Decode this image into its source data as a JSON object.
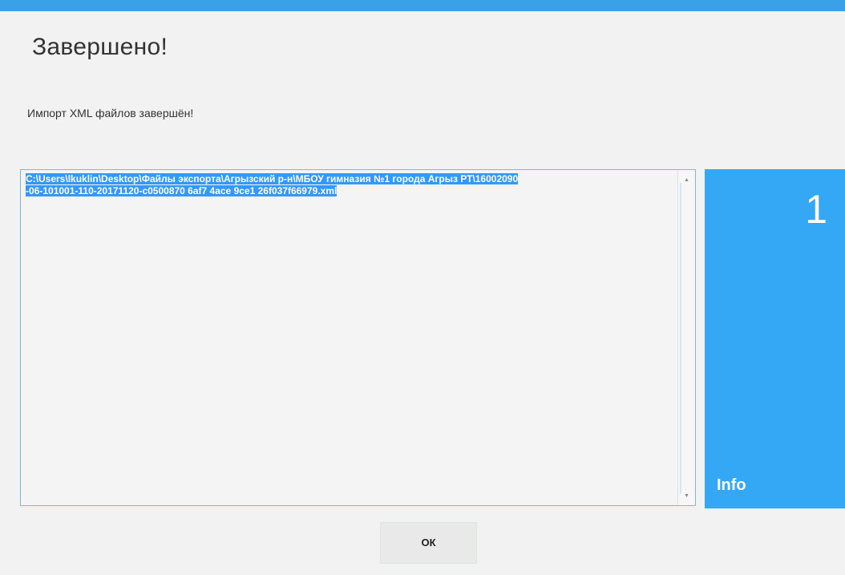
{
  "dialog": {
    "title": "Завершено!",
    "message": "Импорт XML файлов завершён!"
  },
  "log": {
    "lines": [
      "C:\\Users\\lkuklin\\Desktop\\Файлы экспорта\\Агрызский р-н\\МБОУ гимназия №1 города Агрыз РТ\\16002090",
      "-06-101001-110-20171120-c0500870 6af7 4ace 9ce1 26f037f66979.xml"
    ],
    "selected": true
  },
  "info_tile": {
    "count": "1",
    "label": "Info"
  },
  "buttons": {
    "ok_label": "ОК"
  },
  "colors": {
    "accent": "#3aa0e8",
    "tile": "#35a8f5",
    "selection": "#3399ff",
    "background": "#f2f2f2"
  },
  "icons": {
    "scroll_up": "triangle-up-icon",
    "scroll_down": "triangle-down-icon"
  }
}
